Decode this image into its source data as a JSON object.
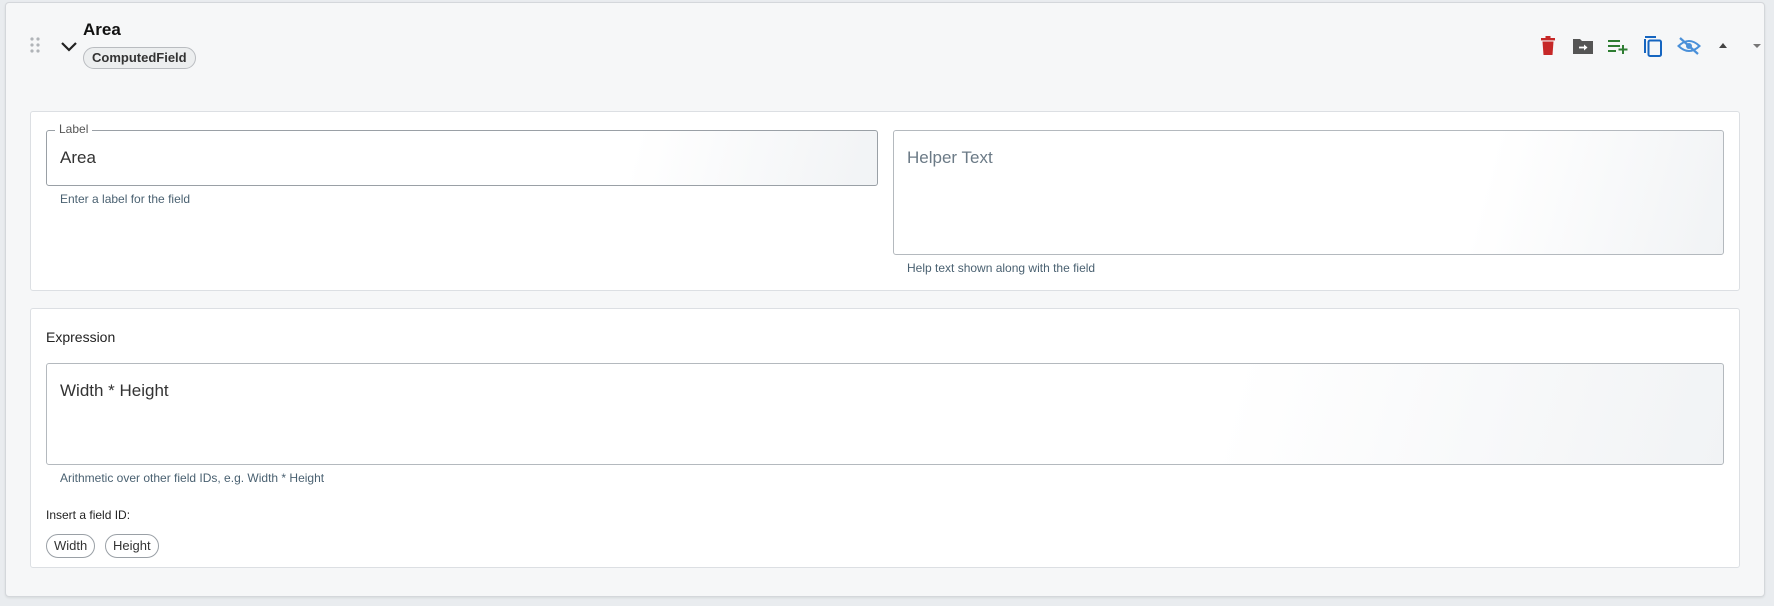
{
  "field": {
    "title": "Area",
    "type": "ComputedField"
  },
  "actions": [
    {
      "name": "delete-icon",
      "color": "#c62828"
    },
    {
      "name": "move-to-folder-icon",
      "color": "#555555"
    },
    {
      "name": "playlist-add-icon",
      "color": "#2e7d32"
    },
    {
      "name": "copy-icon",
      "color": "#1565c0"
    },
    {
      "name": "visibility-off-icon",
      "color": "#4a90d9"
    },
    {
      "name": "arrow-up-icon",
      "color": "#555555"
    },
    {
      "name": "arrow-down-icon",
      "color": "#777777"
    }
  ],
  "label_field": {
    "legend": "Label",
    "value": "Area",
    "hint": "Enter a label for the field"
  },
  "helper_field": {
    "placeholder": "Helper Text",
    "hint": "Help text shown along with the field"
  },
  "expression": {
    "title": "Expression",
    "value": "Width * Height",
    "hint": "Arithmetic over other field IDs, e.g. Width * Height",
    "insert_label": "Insert a field ID:",
    "chips": [
      "Width",
      "Height"
    ]
  }
}
